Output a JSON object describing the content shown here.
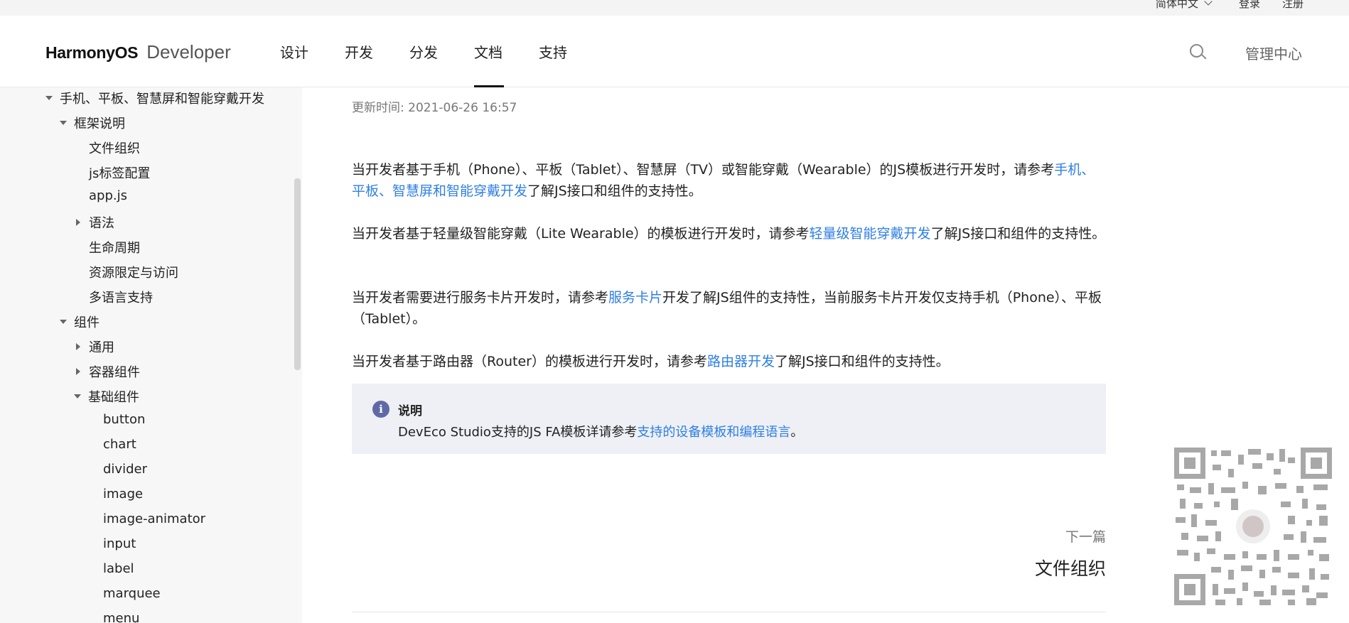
{
  "topbar": {
    "language": "简体中文",
    "login": "登录",
    "register": "注册"
  },
  "header": {
    "brand": "HarmonyOS",
    "brand_suffix": "Developer",
    "nav": [
      "设计",
      "开发",
      "分发",
      "文档",
      "支持"
    ],
    "active_nav": "文档",
    "admin": "管理中心"
  },
  "sidebar": {
    "items": [
      {
        "label": "手机、平板、智慧屏和智能穿戴开发",
        "level": 0,
        "state": "expanded"
      },
      {
        "label": "框架说明",
        "level": 1,
        "state": "expanded"
      },
      {
        "label": "文件组织",
        "level": 2,
        "state": "leaf"
      },
      {
        "label": "js标签配置",
        "level": 2,
        "state": "leaf"
      },
      {
        "label": "app.js",
        "level": 2,
        "state": "leaf"
      },
      {
        "label": "语法",
        "level": 2,
        "state": "collapsed"
      },
      {
        "label": "生命周期",
        "level": 2,
        "state": "leaf"
      },
      {
        "label": "资源限定与访问",
        "level": 2,
        "state": "leaf"
      },
      {
        "label": "多语言支持",
        "level": 2,
        "state": "leaf"
      },
      {
        "label": "组件",
        "level": 1,
        "state": "expanded"
      },
      {
        "label": "通用",
        "level": 2,
        "state": "collapsed"
      },
      {
        "label": "容器组件",
        "level": 2,
        "state": "collapsed"
      },
      {
        "label": "基础组件",
        "level": 2,
        "state": "expanded"
      },
      {
        "label": "button",
        "level": 3,
        "state": "leaf"
      },
      {
        "label": "chart",
        "level": 3,
        "state": "leaf"
      },
      {
        "label": "divider",
        "level": 3,
        "state": "leaf"
      },
      {
        "label": "image",
        "level": 3,
        "state": "leaf"
      },
      {
        "label": "image-animator",
        "level": 3,
        "state": "leaf"
      },
      {
        "label": "input",
        "level": 3,
        "state": "leaf"
      },
      {
        "label": "label",
        "level": 3,
        "state": "leaf"
      },
      {
        "label": "marquee",
        "level": 3,
        "state": "leaf"
      },
      {
        "label": "menu",
        "level": 3,
        "state": "leaf"
      }
    ]
  },
  "main": {
    "updated": "更新时间: 2021-06-26 16:57",
    "p1_a": "当开发者基于手机（Phone）、平板（Tablet）、智慧屏（TV）或智能穿戴（Wearable）的JS模板进行开发时，请参考",
    "p1_link": "手机、平板、智慧屏和智能穿戴开发",
    "p1_b": "了解JS接口和组件的支持性。",
    "p2_a": "当开发者基于轻量级智能穿戴（Lite Wearable）的模板进行开发时，请参考",
    "p2_link": "轻量级智能穿戴开发",
    "p2_b": "了解JS接口和组件的支持性。",
    "p3_a": "当开发者需要进行服务卡片开发时，请参考",
    "p3_link": "服务卡片",
    "p3_b": "开发了解JS组件的支持性，当前服务卡片开发仅支持手机（Phone）、平板（Tablet）。",
    "p4_a": "当开发者基于路由器（Router）的模板进行开发时，请参考",
    "p4_link": "路由器开发",
    "p4_b": "了解JS接口和组件的支持性。",
    "note_title": "说明",
    "note_a": "DevEco Studio支持的JS FA模板详请参考",
    "note_link": "支持的设备模板和编程语言",
    "note_b": "。",
    "next_label": "下一篇",
    "next_title": "文件组织"
  },
  "icons": {
    "info": "info-icon",
    "search": "search-icon",
    "chevron": "chevron-down-icon",
    "qr": "qr-code-icon"
  },
  "colors": {
    "link": "#2f7fe4",
    "note_bg": "#eef0f5",
    "info_icon": "#5f6aa5"
  }
}
